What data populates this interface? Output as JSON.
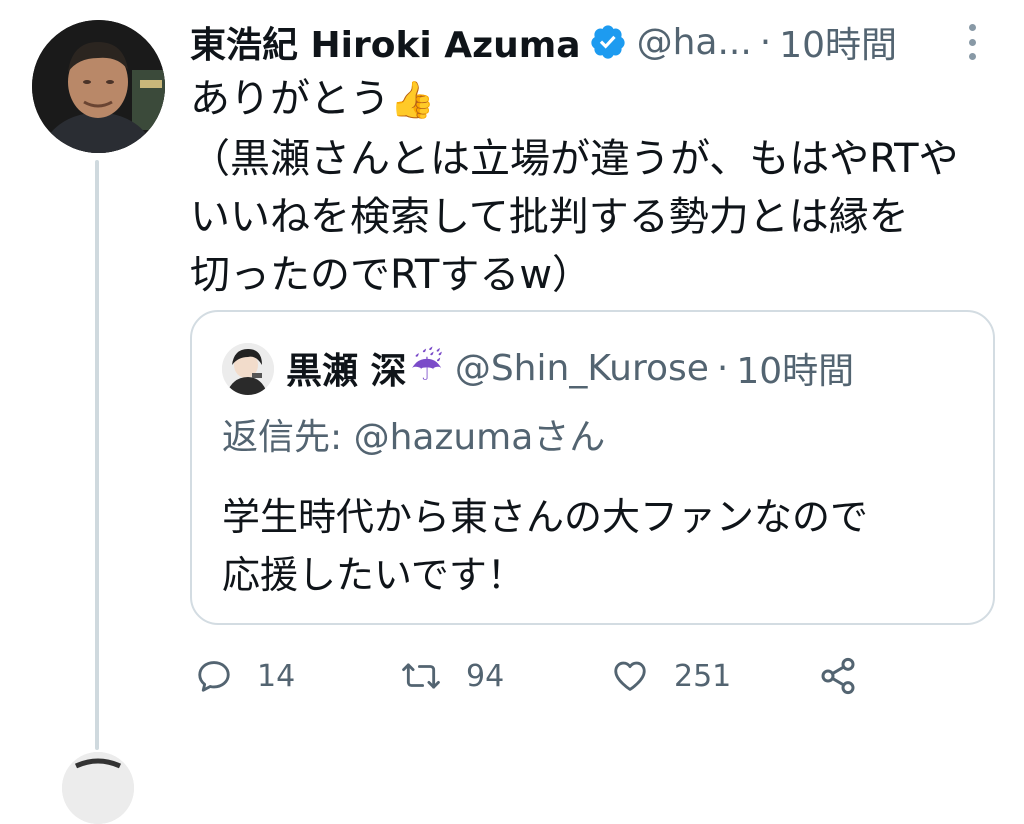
{
  "tweet": {
    "display_name": "東浩紀 Hiroki Azuma",
    "handle": "@ha...",
    "separator": "·",
    "time": "10時間",
    "text_line1": "ありがとう",
    "text_rest": "（黒瀬さんとは立場が違うが、もはやRTや\nいいねを検索して批判する勢力とは縁を\n切ったのでRTするw）",
    "thumb_emoji": "👍"
  },
  "quoted": {
    "display_name": "黒瀬 深",
    "umbrella_emoji": "☔",
    "handle": "@Shin_Kurose",
    "separator": "·",
    "time": "10時間",
    "reply_to": "返信先: @hazumaさん",
    "text": "学生時代から東さんの大ファンなので\n応援したいです！"
  },
  "actions": {
    "replies": "14",
    "retweets": "94",
    "likes": "251"
  },
  "colors": {
    "verified": "#1d9bf0",
    "secondary_text": "#536471",
    "border": "#d3dce2",
    "thread_line": "#cfd9de"
  }
}
